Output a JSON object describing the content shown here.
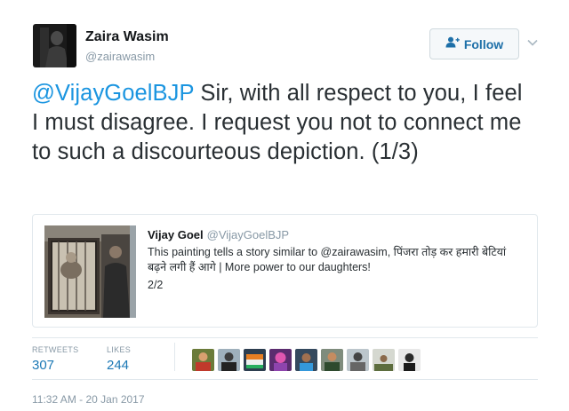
{
  "author": {
    "name": "Zaira Wasim",
    "handle": "@zairawasim"
  },
  "follow_button": {
    "label": "Follow"
  },
  "tweet": {
    "mention": "@VijayGoelBJP",
    "text": " Sir, with all respect to you, I feel I must disagree. I request you not to connect me to such a discourteous depiction. (1/3)"
  },
  "quoted_tweet": {
    "name": "Vijay Goel",
    "handle": "@VijayGoelBJP",
    "text": "This painting tells a story similar to @zairawasim, पिंजरा तोड़ कर हमारी बेटियां बढ़ने लगी हैं आगे | More power to our daughters!",
    "count": "2/2"
  },
  "stats": {
    "retweets_label": "RETWEETS",
    "retweets_value": "307",
    "likes_label": "LIKES",
    "likes_value": "244"
  },
  "timestamp": "11:32 AM - 20 Jan 2017",
  "icons": {
    "follow": "add-user-icon",
    "caret": "chevron-down-icon"
  },
  "colors": {
    "link": "#1b95e0",
    "stat_value": "#1b78b5",
    "muted": "#8899a6"
  }
}
